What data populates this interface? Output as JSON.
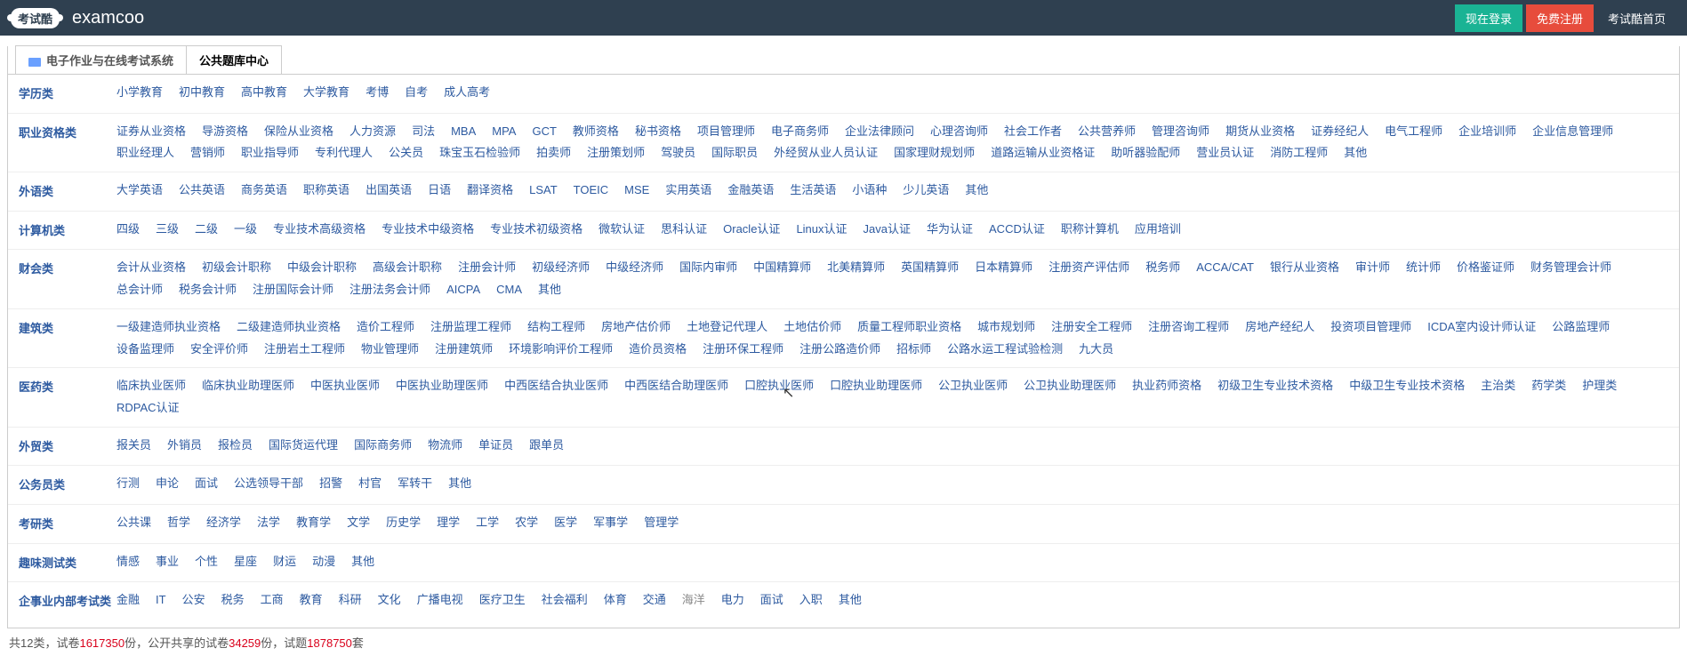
{
  "header": {
    "logo_badge": "考试酷",
    "logo_text": "examcoo",
    "login": "现在登录",
    "register": "免费注册",
    "home": "考试酷首页"
  },
  "tabs": {
    "tab1": "电子作业与在线考试系统",
    "tab2": "公共题库中心"
  },
  "categories": [
    {
      "name": "学历类",
      "links": [
        "小学教育",
        "初中教育",
        "高中教育",
        "大学教育",
        "考博",
        "自考",
        "成人高考"
      ]
    },
    {
      "name": "职业资格类",
      "links": [
        "证券从业资格",
        "导游资格",
        "保险从业资格",
        "人力资源",
        "司法",
        "MBA",
        "MPA",
        "GCT",
        "教师资格",
        "秘书资格",
        "项目管理师",
        "电子商务师",
        "企业法律顾问",
        "心理咨询师",
        "社会工作者",
        "公共营养师",
        "管理咨询师",
        "期货从业资格",
        "证券经纪人",
        "电气工程师",
        "企业培训师",
        "企业信息管理师",
        "职业经理人",
        "营销师",
        "职业指导师",
        "专利代理人",
        "公关员",
        "珠宝玉石检验师",
        "拍卖师",
        "注册策划师",
        "驾驶员",
        "国际职员",
        "外经贸从业人员认证",
        "国家理财规划师",
        "道路运输从业资格证",
        "助听器验配师",
        "营业员认证",
        "消防工程师",
        "其他"
      ]
    },
    {
      "name": "外语类",
      "links": [
        "大学英语",
        "公共英语",
        "商务英语",
        "职称英语",
        "出国英语",
        "日语",
        "翻译资格",
        "LSAT",
        "TOEIC",
        "MSE",
        "实用英语",
        "金融英语",
        "生活英语",
        "小语种",
        "少儿英语",
        "其他"
      ]
    },
    {
      "name": "计算机类",
      "links": [
        "四级",
        "三级",
        "二级",
        "一级",
        "专业技术高级资格",
        "专业技术中级资格",
        "专业技术初级资格",
        "微软认证",
        "思科认证",
        "Oracle认证",
        "Linux认证",
        "Java认证",
        "华为认证",
        "ACCD认证",
        "职称计算机",
        "应用培训"
      ]
    },
    {
      "name": "财会类",
      "links": [
        "会计从业资格",
        "初级会计职称",
        "中级会计职称",
        "高级会计职称",
        "注册会计师",
        "初级经济师",
        "中级经济师",
        "国际内审师",
        "中国精算师",
        "北美精算师",
        "英国精算师",
        "日本精算师",
        "注册资产评估师",
        "税务师",
        "ACCA/CAT",
        "银行从业资格",
        "审计师",
        "统计师",
        "价格鉴证师",
        "财务管理会计师",
        "总会计师",
        "税务会计师",
        "注册国际会计师",
        "注册法务会计师",
        "AICPA",
        "CMA",
        "其他"
      ]
    },
    {
      "name": "建筑类",
      "links": [
        "一级建造师执业资格",
        "二级建造师执业资格",
        "造价工程师",
        "注册监理工程师",
        "结构工程师",
        "房地产估价师",
        "土地登记代理人",
        "土地估价师",
        "质量工程师职业资格",
        "城市规划师",
        "注册安全工程师",
        "注册咨询工程师",
        "房地产经纪人",
        "投资项目管理师",
        "ICDA室内设计师认证",
        "公路监理师",
        "设备监理师",
        "安全评价师",
        "注册岩土工程师",
        "物业管理师",
        "注册建筑师",
        "环境影响评价工程师",
        "造价员资格",
        "注册环保工程师",
        "注册公路造价师",
        "招标师",
        "公路水运工程试验检测",
        "九大员"
      ]
    },
    {
      "name": "医药类",
      "links": [
        "临床执业医师",
        "临床执业助理医师",
        "中医执业医师",
        "中医执业助理医师",
        "中西医结合执业医师",
        "中西医结合助理医师",
        "口腔执业医师",
        "口腔执业助理医师",
        "公卫执业医师",
        "公卫执业助理医师",
        "执业药师资格",
        "初级卫生专业技术资格",
        "中级卫生专业技术资格",
        "主治类",
        "药学类",
        "护理类",
        "RDPAC认证"
      ]
    },
    {
      "name": "外贸类",
      "links": [
        "报关员",
        "外销员",
        "报检员",
        "国际货运代理",
        "国际商务师",
        "物流师",
        "单证员",
        "跟单员"
      ]
    },
    {
      "name": "公务员类",
      "links": [
        "行测",
        "申论",
        "面试",
        "公选领导干部",
        "招警",
        "村官",
        "军转干",
        "其他"
      ]
    },
    {
      "name": "考研类",
      "links": [
        "公共课",
        "哲学",
        "经济学",
        "法学",
        "教育学",
        "文学",
        "历史学",
        "理学",
        "工学",
        "农学",
        "医学",
        "军事学",
        "管理学"
      ]
    },
    {
      "name": "趣味测试类",
      "links": [
        "情感",
        "事业",
        "个性",
        "星座",
        "财运",
        "动漫",
        "其他"
      ]
    },
    {
      "name": "企事业内部考试类",
      "links": [
        "金融",
        "IT",
        "公安",
        "税务",
        "工商",
        "教育",
        "科研",
        "文化",
        "广播电视",
        "医疗卫生",
        "社会福利",
        "体育",
        "交通",
        "海洋",
        "电力",
        "面试",
        "入职",
        "其他"
      ],
      "muted_index": 13
    }
  ],
  "footer": {
    "t1": "共12类，试卷",
    "n1": "1617350",
    "t2": "份，公开共享的试卷",
    "n2": "34259",
    "t3": "份，试题",
    "n3": "1878750",
    "t4": "套"
  }
}
